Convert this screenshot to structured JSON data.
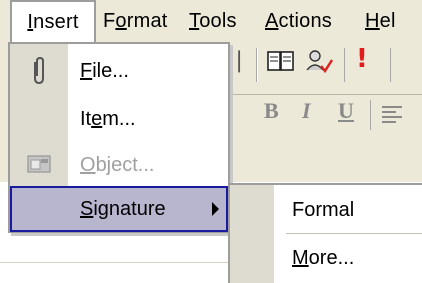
{
  "menubar": {
    "items": [
      {
        "label": "Insert",
        "access": "I",
        "rest": "nsert"
      },
      {
        "label": "Format",
        "pre": "F",
        "access": "o",
        "rest": "rmat"
      },
      {
        "label": "Tools",
        "access": "T",
        "rest": "ools"
      },
      {
        "label": "Actions",
        "access": "A",
        "rest": "ctions"
      },
      {
        "label": "Hel",
        "access": "H",
        "rest": "el"
      }
    ]
  },
  "insert_menu": {
    "items": [
      {
        "label_access": "F",
        "label_rest": "ile...",
        "icon": "paperclip-icon",
        "enabled": true
      },
      {
        "label_pre": "It",
        "label_access": "e",
        "label_rest": "m...",
        "icon": "",
        "enabled": true
      },
      {
        "label_access": "O",
        "label_rest": "bject...",
        "icon": "object-icon",
        "enabled": false
      },
      {
        "label_access": "S",
        "label_rest": "ignature",
        "icon": "",
        "enabled": true,
        "submenu": true
      }
    ]
  },
  "signature_submenu": {
    "items": [
      {
        "label": "Formal"
      },
      {
        "label_access": "M",
        "label_rest": "ore..."
      }
    ]
  },
  "toolbar": {
    "icons": [
      "address-book-icon",
      "check-names-icon",
      "importance-high-icon",
      "bold-icon",
      "italic-icon",
      "underline-icon",
      "align-icon"
    ],
    "bold_label": "B",
    "italic_label": "I",
    "underline_label": "U",
    "importance_label": "!"
  },
  "colors": {
    "menubar_bg": "#ece9d8",
    "selection_bg": "#b8b6cf",
    "selection_border": "#1a1a9e",
    "disabled_text": "#a0a0a0",
    "importance_red": "#e21b1b"
  }
}
